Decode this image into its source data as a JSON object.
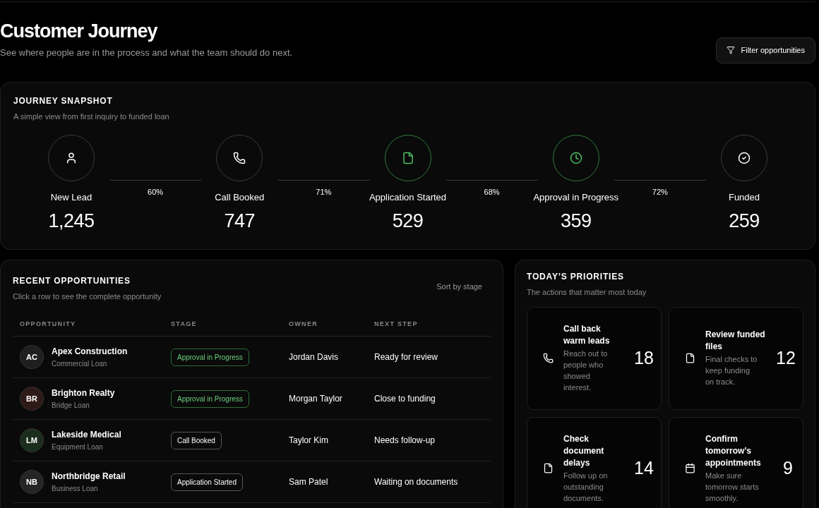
{
  "header": {
    "title": "Customer Journey",
    "subtitle": "See where people are in the process and what the team should do next.",
    "filter_button": "Filter opportunities"
  },
  "snapshot": {
    "title": "JOURNEY SNAPSHOT",
    "subtitle": "A simple view from first inquiry to funded loan",
    "stages": [
      {
        "kind": "person",
        "label": "New Lead",
        "count": "1,245",
        "active": false,
        "conversion": "60%"
      },
      {
        "kind": "phone",
        "label": "Call Booked",
        "count": "747",
        "active": false,
        "conversion": "71%"
      },
      {
        "kind": "file",
        "label": "Application Started",
        "count": "529",
        "active": true,
        "conversion": "68%"
      },
      {
        "kind": "clock",
        "label": "Approval in Progress",
        "count": "359",
        "active": true,
        "conversion": "72%"
      },
      {
        "kind": "check",
        "label": "Funded",
        "count": "259",
        "active": false
      }
    ]
  },
  "opportunities": {
    "title": "RECENT OPPORTUNITIES",
    "subtitle": "Click a row to see the complete opportunity",
    "sort": "Sort by stage",
    "columns": [
      "OPPORTUNITY",
      "STAGE",
      "OWNER",
      "NEXT STEP"
    ],
    "rows": [
      {
        "initials": "AC",
        "color": "#1f1f1f",
        "name": "Apex Construction",
        "loan": "Commercial Loan",
        "stage": "Approval in Progress",
        "highlight": true,
        "owner": "Jordan Davis",
        "next_step": "Ready for review"
      },
      {
        "initials": "BR",
        "color": "#2e1a17",
        "name": "Brighton Realty",
        "loan": "Bridge Loan",
        "stage": "Approval in Progress",
        "highlight": true,
        "owner": "Morgan Taylor",
        "next_step": "Close to funding"
      },
      {
        "initials": "LM",
        "color": "#1b2e1c",
        "name": "Lakeside Medical",
        "loan": "Equipment Loan",
        "stage": "Call Booked",
        "highlight": false,
        "owner": "Taylor Kim",
        "next_step": "Needs follow-up"
      },
      {
        "initials": "NB",
        "color": "#252525",
        "name": "Northbridge Retail",
        "loan": "Business Loan",
        "stage": "Application Started",
        "highlight": false,
        "owner": "Sam Patel",
        "next_step": "Waiting on documents"
      }
    ]
  },
  "priorities": {
    "title": "TODAY’S PRIORITIES",
    "subtitle": "The actions that matter most today",
    "items": [
      {
        "kind": "phone",
        "title": "Call back warm leads",
        "description": "Reach out to people who showed interest.",
        "count": "18"
      },
      {
        "kind": "file",
        "title": "Review funded files",
        "description": "Final checks to keep funding on track.",
        "count": "12"
      },
      {
        "kind": "file",
        "title": "Check document delays",
        "description": "Follow up on outstanding documents.",
        "count": "14"
      },
      {
        "kind": "calendar",
        "title": "Confirm tomorrow’s appointments",
        "description": "Make sure tomorrow starts smoothly.",
        "count": "9"
      }
    ]
  }
}
